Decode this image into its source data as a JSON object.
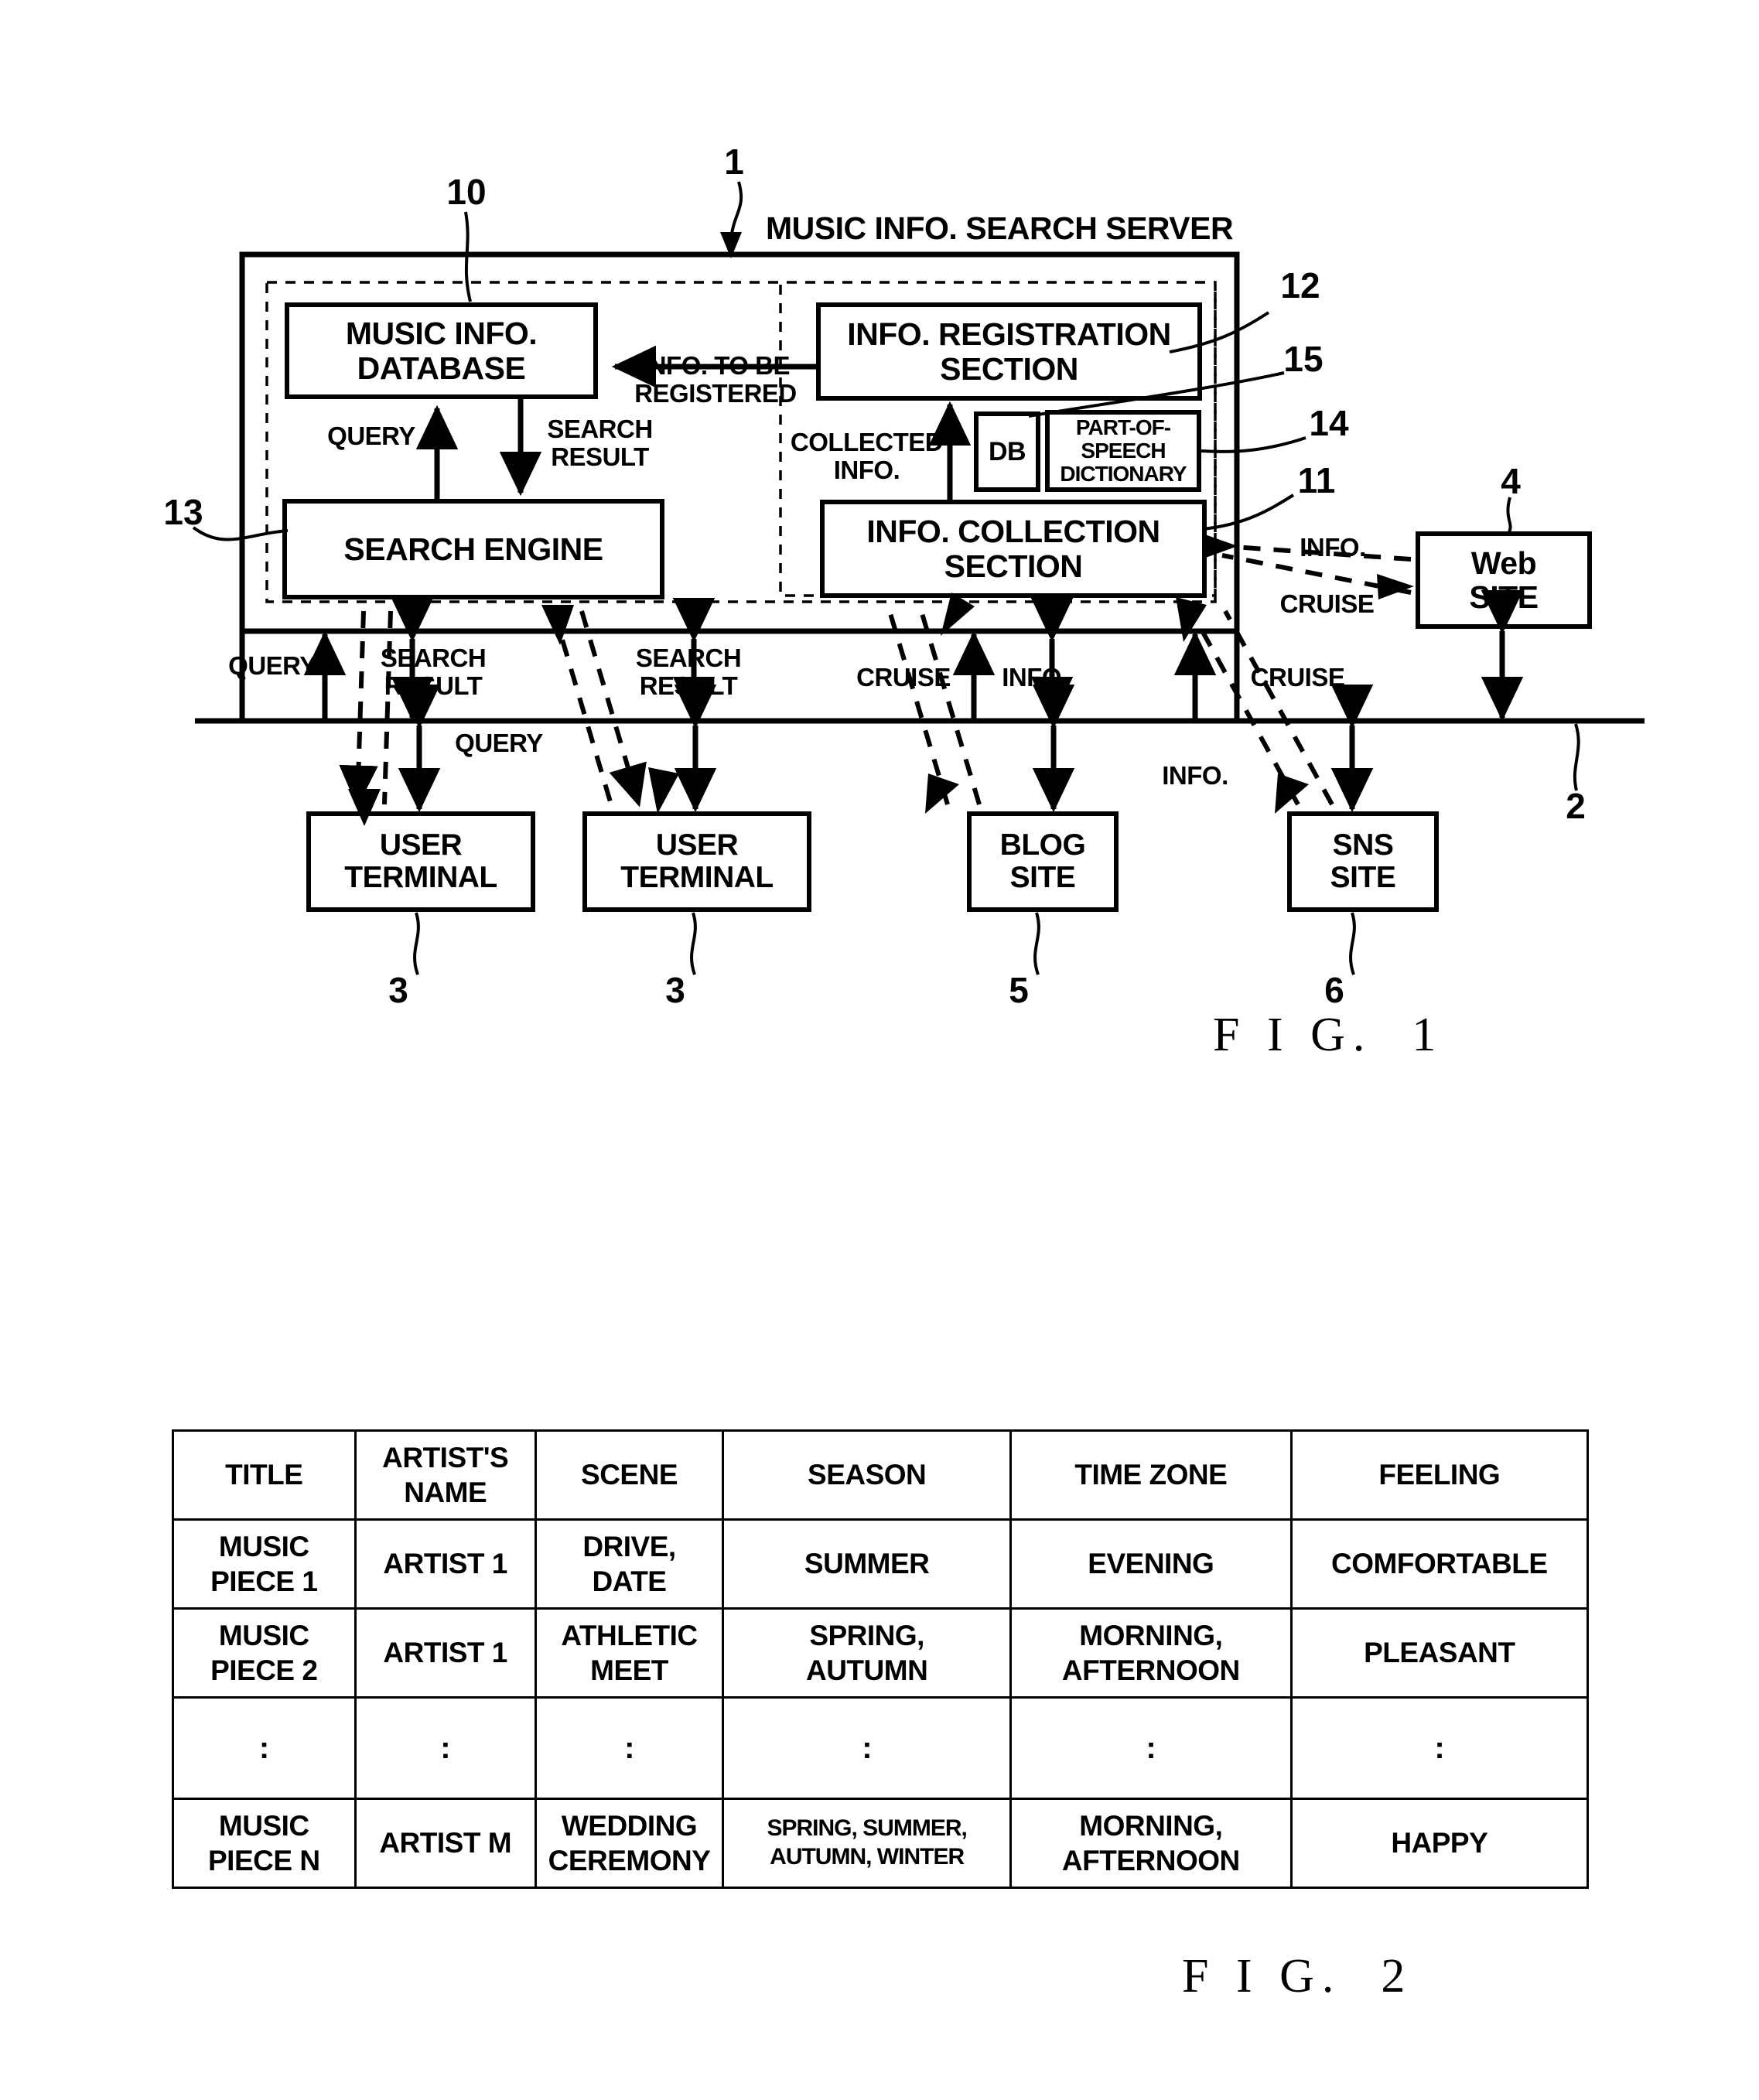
{
  "figure1": {
    "caption": "F I G.  1",
    "server_title": "MUSIC INFO. SEARCH SERVER",
    "ref_numbers": {
      "server": "1",
      "network": "2",
      "user_terminal_a": "3",
      "user_terminal_b": "3",
      "web_site": "4",
      "blog_site": "5",
      "sns_site": "6",
      "music_info_database": "10",
      "info_collection_section": "11",
      "info_registration_section": "12",
      "search_engine": "13",
      "part_of_speech_dictionary": "14",
      "db": "15"
    },
    "boxes": {
      "music_info_database": "MUSIC INFO.\nDATABASE",
      "info_registration_section": "INFO. REGISTRATION\nSECTION",
      "search_engine": "SEARCH ENGINE",
      "info_collection_section": "INFO. COLLECTION\nSECTION",
      "db": "DB",
      "part_of_speech_dictionary": "PART-OF-\nSPEECH\nDICTIONARY",
      "web_site": "Web\nSITE",
      "user_terminal_a": "USER\nTERMINAL",
      "user_terminal_b": "USER\nTERMINAL",
      "blog_site": "BLOG\nSITE",
      "sns_site": "SNS\nSITE"
    },
    "edge_labels": {
      "info_to_be_registered": "INFO. TO BE\nREGISTERED",
      "query_db": "QUERY",
      "search_result_db": "SEARCH\nRESULT",
      "collected_info": "COLLECTED\nINFO.",
      "query_net_left": "QUERY",
      "search_result_net_left": "SEARCH\nRESULT",
      "search_result_net_mid": "SEARCH\nRESULT",
      "query_net_mid": "QUERY",
      "cruise_blog": "CRUISE",
      "info_blog": "INFO.",
      "cruise_sns": "CRUISE",
      "info_sns": "INFO.",
      "info_web": "INFO.",
      "cruise_web": "CRUISE"
    }
  },
  "figure2": {
    "caption": "F I G.  2",
    "table": {
      "headers": [
        "TITLE",
        "ARTIST'S\nNAME",
        "SCENE",
        "SEASON",
        "TIME ZONE",
        "FEELING"
      ],
      "rows": [
        {
          "title": "MUSIC\nPIECE 1",
          "artist": "ARTIST 1",
          "scene": "DRIVE,\nDATE",
          "season": "SUMMER",
          "time_zone": "EVENING",
          "feeling": "COMFORTABLE"
        },
        {
          "title": "MUSIC\nPIECE 2",
          "artist": "ARTIST 1",
          "scene": "ATHLETIC\nMEET",
          "season": "SPRING,\nAUTUMN",
          "time_zone": "MORNING,\nAFTERNOON",
          "feeling": "PLEASANT"
        },
        {
          "title": ":",
          "artist": ":",
          "scene": ":",
          "season": ":",
          "time_zone": ":",
          "feeling": ":"
        },
        {
          "title": "MUSIC\nPIECE N",
          "artist": "ARTIST M",
          "scene": "WEDDING\nCEREMONY",
          "season": "SPRING, SUMMER,\nAUTUMN, WINTER",
          "time_zone": "MORNING,\nAFTERNOON",
          "feeling": "HAPPY"
        }
      ]
    }
  }
}
